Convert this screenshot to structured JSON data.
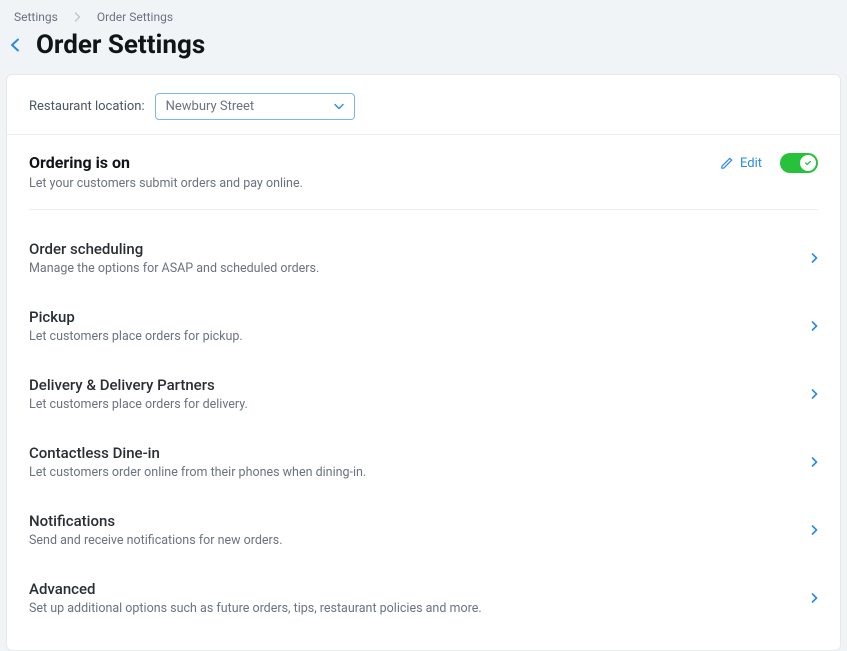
{
  "breadcrumb": {
    "root": "Settings",
    "current": "Order Settings"
  },
  "page_title": "Order Settings",
  "location": {
    "label": "Restaurant location:",
    "selected": "Newbury Street"
  },
  "ordering": {
    "title": "Ordering is on",
    "subtitle": "Let your customers submit orders and pay online.",
    "edit_label": "Edit",
    "toggle_on": true
  },
  "sections": [
    {
      "title": "Order scheduling",
      "subtitle": "Manage the options for ASAP and scheduled orders."
    },
    {
      "title": "Pickup",
      "subtitle": "Let customers place orders for pickup."
    },
    {
      "title": "Delivery & Delivery Partners",
      "subtitle": "Let customers place orders for delivery."
    },
    {
      "title": "Contactless Dine-in",
      "subtitle": "Let customers order online from their phones when dining-in."
    },
    {
      "title": "Notifications",
      "subtitle": "Send and receive notifications for new orders."
    },
    {
      "title": "Advanced",
      "subtitle": "Set up additional options such as future orders, tips, restaurant policies and more."
    }
  ]
}
